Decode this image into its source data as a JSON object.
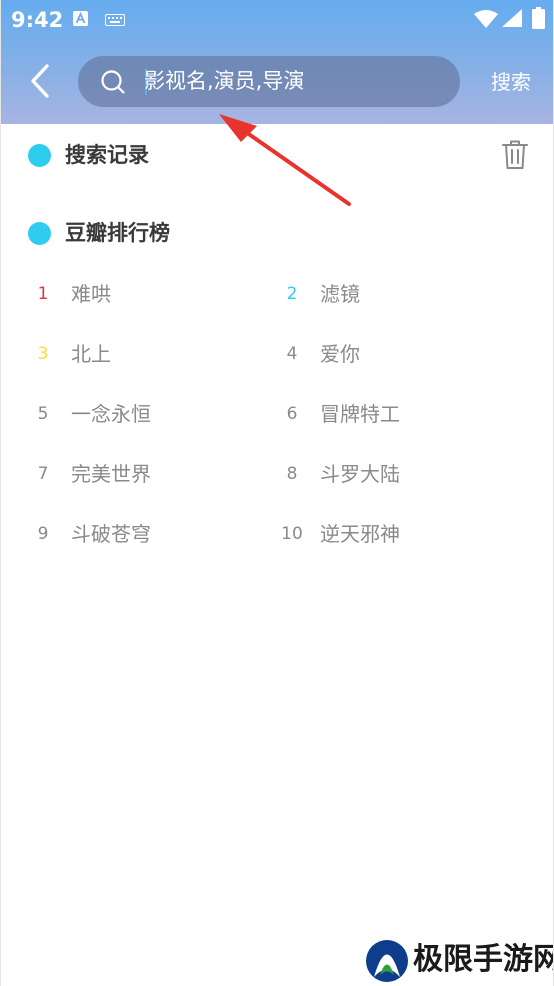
{
  "status_bar": {
    "time": "9:42",
    "icons": [
      "app-a-icon",
      "keyboard-icon",
      "wifi-icon",
      "signal-icon",
      "battery-icon"
    ]
  },
  "header": {
    "search_placeholder": "影视名,演员,导演",
    "search_value": "",
    "search_button": "搜索"
  },
  "history": {
    "title": "搜索记录",
    "items": []
  },
  "ranking": {
    "title": "豆瓣排行榜",
    "items": [
      {
        "rank": "1",
        "title": "难哄",
        "color": "#e8323c"
      },
      {
        "rank": "2",
        "title": "滤镜",
        "color": "#2ecdf0"
      },
      {
        "rank": "3",
        "title": "北上",
        "color": "#f1e62c"
      },
      {
        "rank": "4",
        "title": "爱你",
        "color": "#8a8a8a"
      },
      {
        "rank": "5",
        "title": "一念永恒",
        "color": "#8a8a8a"
      },
      {
        "rank": "6",
        "title": "冒牌特工",
        "color": "#8a8a8a"
      },
      {
        "rank": "7",
        "title": "完美世界",
        "color": "#8a8a8a"
      },
      {
        "rank": "8",
        "title": "斗罗大陆",
        "color": "#8a8a8a"
      },
      {
        "rank": "9",
        "title": "斗破苍穹",
        "color": "#8a8a8a"
      },
      {
        "rank": "10",
        "title": "逆天邪神",
        "color": "#8a8a8a"
      }
    ]
  },
  "colors": {
    "accent_dot": "#2ecdf0",
    "annotation_arrow": "#e8332e",
    "text_gray": "#8a8a8a"
  },
  "watermark": {
    "text": "极限手游网"
  }
}
